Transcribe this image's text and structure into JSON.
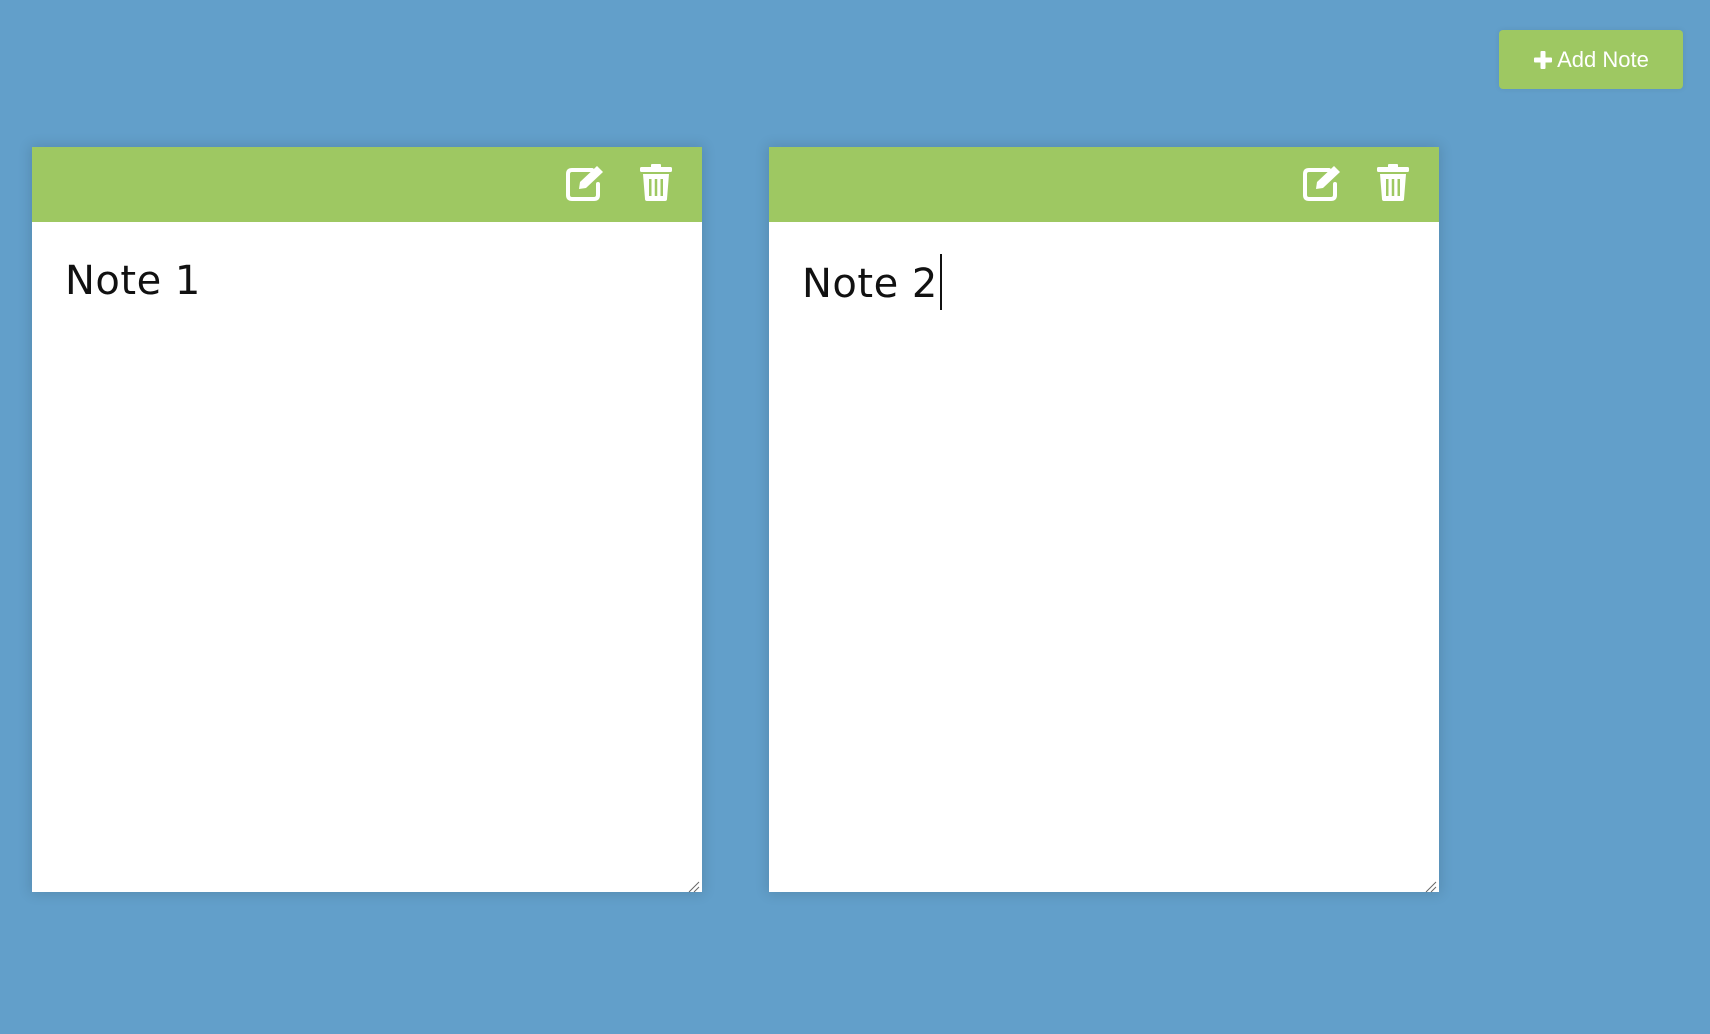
{
  "toolbar": {
    "add_note_label": "Add Note",
    "add_icon": "plus-icon"
  },
  "notes": [
    {
      "text": "Note 1",
      "focused": false,
      "edit_icon": "edit-icon",
      "delete_icon": "trash-icon"
    },
    {
      "text": "Note 2",
      "focused": true,
      "edit_icon": "edit-icon",
      "delete_icon": "trash-icon"
    }
  ],
  "colors": {
    "background": "#629fca",
    "accent": "#9ec862",
    "note_body": "#ffffff",
    "text": "#111111"
  }
}
